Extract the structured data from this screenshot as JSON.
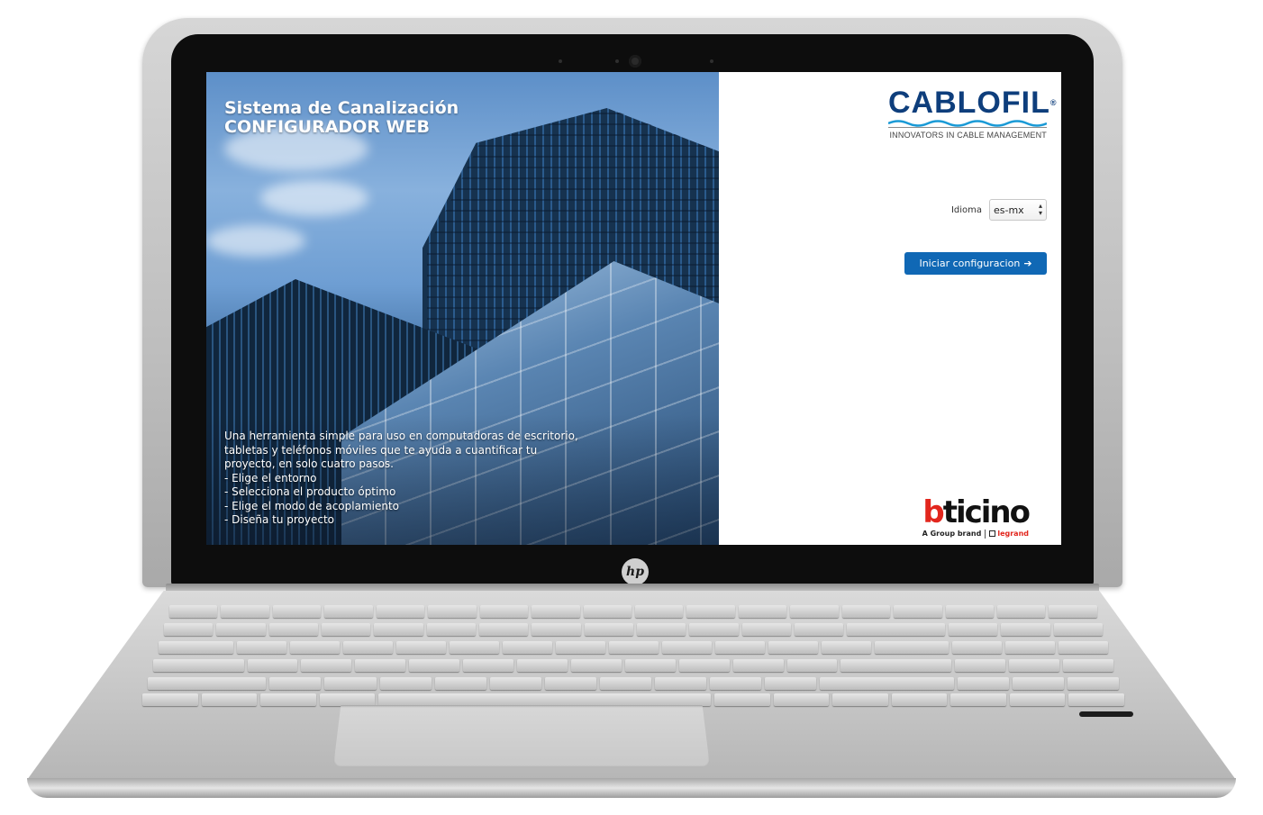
{
  "hero": {
    "title_line1": "Sistema de Canalización",
    "title_line2": "CONFIGURADOR WEB",
    "description": "Una herramienta simple para uso en computadoras de escritorio, tabletas y teléfonos móviles que te ayuda a cuantificar tu proyecto, en solo cuatro pasos.",
    "steps": [
      "- Elige el entorno",
      "- Selecciona el producto óptimo",
      "- Elige el modo de acoplamiento",
      "- Diseña tu proyecto"
    ]
  },
  "brand": {
    "name": "CABLOFIL",
    "trademark": "®",
    "tagline": "INNOVATORS IN CABLE MANAGEMENT",
    "color": "#0e3e7c"
  },
  "language": {
    "label": "Idioma",
    "selected": "es-mx",
    "caret": "▴▾"
  },
  "start_button": {
    "label": "Iniciar configuracion",
    "icon": "arrow-right-icon",
    "arrow": "➔",
    "color": "#1068b5"
  },
  "partner": {
    "name_first": "b",
    "name_rest": "ticino",
    "group_text": "A Group brand",
    "legrand": "legrand",
    "accent_color": "#e2261d"
  },
  "device": {
    "logo_text": "hp"
  }
}
